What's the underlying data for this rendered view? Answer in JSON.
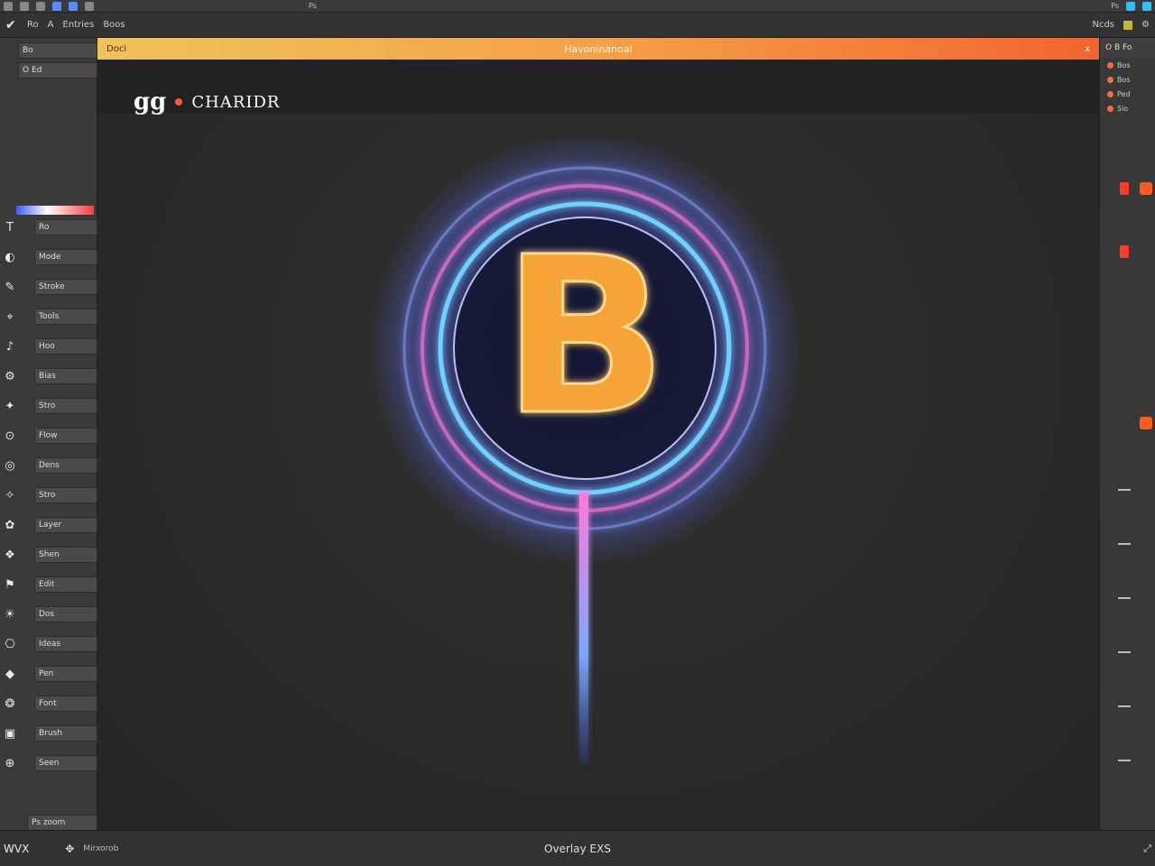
{
  "menubar": {
    "title": "Ps",
    "right_label": "Ps"
  },
  "options_bar": {
    "tool_label": "Ro",
    "field1": "A",
    "field2": "Entries",
    "field3": "Boos",
    "right_label": "Ncds"
  },
  "left_panel": {
    "header1": "Bo",
    "header2": "O Ed",
    "items": [
      {
        "icon": "T",
        "label": "Ro"
      },
      {
        "icon": "◐",
        "label": "Mode"
      },
      {
        "icon": "✎",
        "label": "Stroke"
      },
      {
        "icon": "⌖",
        "label": "Tools"
      },
      {
        "icon": "♪",
        "label": "Hoo"
      },
      {
        "icon": "⚙",
        "label": "Bias"
      },
      {
        "icon": "✦",
        "label": "Stro"
      },
      {
        "icon": "⊙",
        "label": "Flow"
      },
      {
        "icon": "◎",
        "label": "Dens"
      },
      {
        "icon": "✧",
        "label": "Stro"
      },
      {
        "icon": "✿",
        "label": "Layer"
      },
      {
        "icon": "❖",
        "label": "Shen"
      },
      {
        "icon": "⚑",
        "label": "Edit"
      },
      {
        "icon": "☀",
        "label": "Dos"
      },
      {
        "icon": "⎔",
        "label": "Ideas"
      },
      {
        "icon": "◆",
        "label": "Pen"
      },
      {
        "icon": "❂",
        "label": "Font"
      },
      {
        "icon": "▣",
        "label": "Brush"
      },
      {
        "icon": "⊕",
        "label": "Seen"
      }
    ],
    "footer": "Ps zoom"
  },
  "document": {
    "tab_name": "Doci",
    "tab_title": "Havoninanoal",
    "tab_close": "x"
  },
  "canvas": {
    "logo_mark": "gg",
    "logo_word": "CHARIDR"
  },
  "right_panel": {
    "header": "O B Fo",
    "items": [
      {
        "label": "Bos"
      },
      {
        "label": "Bos"
      },
      {
        "label": "Ped"
      },
      {
        "label": "Sio"
      }
    ]
  },
  "statusbar": {
    "left": "WVX",
    "zoom": "Mirxorob",
    "center": "Overlay EXS"
  },
  "colors": {
    "tab_start": "#f0c35a",
    "tab_end": "#f3642c",
    "glow_blue": "#5b8cff",
    "glow_pink": "#ff7ad9",
    "letter_orange": "#f6a438"
  }
}
